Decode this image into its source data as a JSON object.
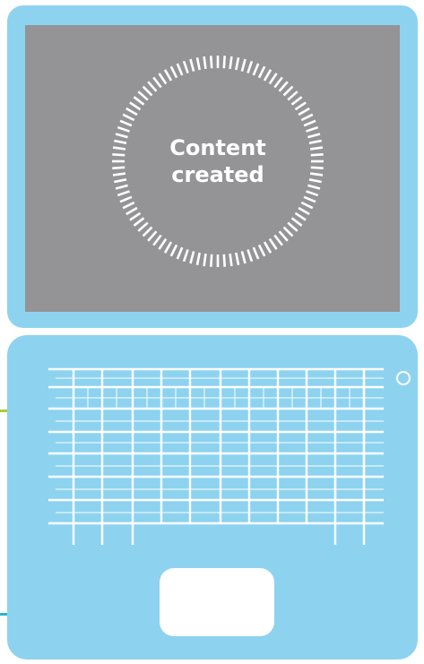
{
  "screen": {
    "label_line1": "Content",
    "label_line2": "created"
  },
  "colors": {
    "body": "#8dd3f0",
    "screen": "#949396",
    "white": "#ffffff",
    "green_accent": "#a6ce39",
    "teal_accent": "#29b6c6"
  },
  "icons": {
    "dial": "tick-ring-icon",
    "power": "power-button-icon"
  }
}
